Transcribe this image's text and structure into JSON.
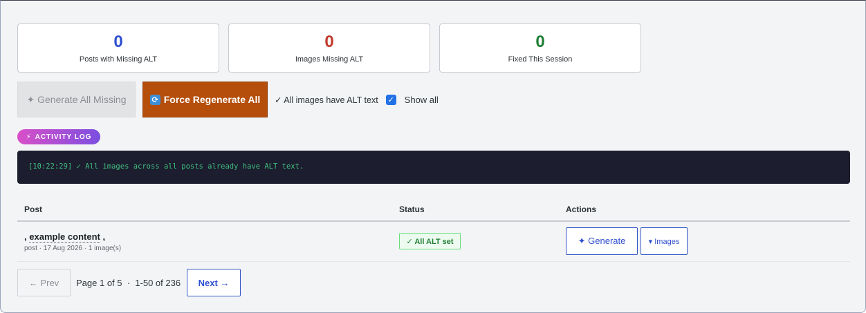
{
  "stats": [
    {
      "value": "0",
      "label": "Posts with Missing ALT",
      "color": "#2f4fd0"
    },
    {
      "value": "0",
      "label": "Images Missing ALT",
      "color": "#c0392b"
    },
    {
      "value": "0",
      "label": "Fixed This Session",
      "color": "#1e7e34"
    }
  ],
  "toolbar": {
    "generate_all_label": "✦ Generate All Missing",
    "force_regen_icon": "refresh-icon",
    "force_regen_label": "Force Regenerate All",
    "status_text": "✓ All images have ALT text",
    "show_all_checked": true,
    "show_all_label": "Show all"
  },
  "activity_log": {
    "badge_icon": "⚡",
    "badge_label": "ACTIVITY LOG",
    "entries": [
      "[10:22:29] ✓ All images across all posts already have ALT text."
    ]
  },
  "table": {
    "headers": [
      "Post",
      "Status",
      "Actions"
    ],
    "rows": [
      {
        "title_prefix": ",",
        "title": "example content",
        "title_suffix": ",",
        "meta": "post · 17 Aug 2026 · 1 image(s)",
        "status": "✓ All ALT set",
        "generate_label": "✦ Generate",
        "images_label": "▾ Images"
      }
    ]
  },
  "pagination": {
    "prev_label": "← Prev",
    "info": "Page 1 of 5  ·  1-50 of 236",
    "next_label": "Next →"
  },
  "colors": {
    "accent": "#2f4fd0",
    "force_button": "#b54e0a",
    "log_bg": "#1c1d2e",
    "log_text": "#3fbf7f"
  }
}
